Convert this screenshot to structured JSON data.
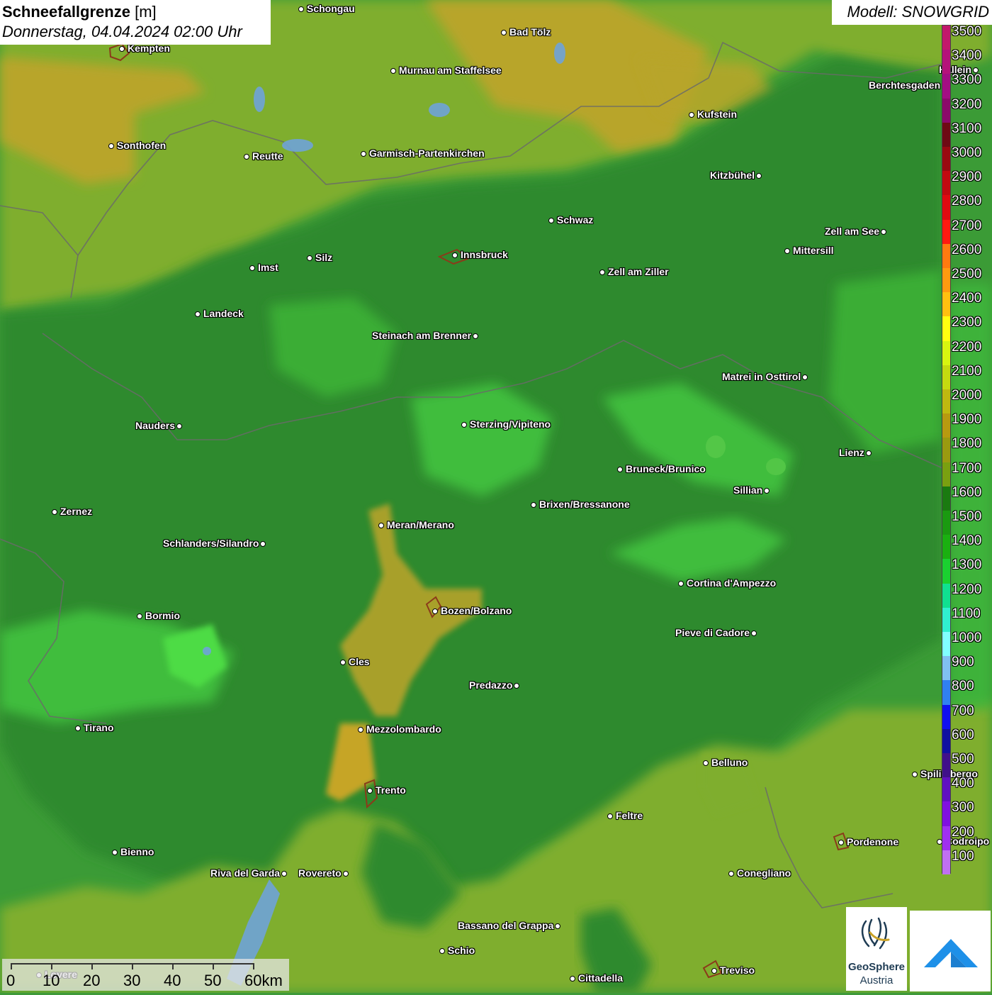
{
  "title": {
    "main": "Schneefallgrenze",
    "unit": "[m]",
    "datetime": "Donnerstag, 04.04.2024 02:00 Uhr"
  },
  "model": "Modell: SNOWGRID",
  "legend": {
    "labels": [
      "3500",
      "3400",
      "3300",
      "3200",
      "3100",
      "3000",
      "2900",
      "2800",
      "2700",
      "2600",
      "2500",
      "2400",
      "2300",
      "2200",
      "2100",
      "2000",
      "1900",
      "1800",
      "1700",
      "1600",
      "1500",
      "1400",
      "1300",
      "1200",
      "1100",
      "1000",
      "900",
      "800",
      "700",
      "600",
      "500",
      "400",
      "300",
      "200",
      "100"
    ],
    "colors": [
      "#c2186b",
      "#b5127a",
      "#a30e83",
      "#8c0a6a",
      "#6e0a14",
      "#9a0a10",
      "#c20a10",
      "#e00a10",
      "#ff1a10",
      "#ff7a10",
      "#ff9a10",
      "#ffc010",
      "#ffff10",
      "#d8f510",
      "#c4da10",
      "#c0b810",
      "#b89a10",
      "#9a9a10",
      "#7aa010",
      "#1a7a10",
      "#1a9a10",
      "#1ab010",
      "#1ad030",
      "#10e090",
      "#30f0d0",
      "#80ffff",
      "#80c0f0",
      "#3080f0",
      "#1010f0",
      "#1010a0",
      "#40108a",
      "#6010c0",
      "#8010e0",
      "#a030f0",
      "#c070f0"
    ]
  },
  "cities": [
    {
      "name": "Schongau"
    },
    {
      "name": "Bad Tölz"
    },
    {
      "name": "Kempten"
    },
    {
      "name": "Murnau am Staffelsee"
    },
    {
      "name": "Hallein"
    },
    {
      "name": "Berchtesgaden"
    },
    {
      "name": "Kufstein"
    },
    {
      "name": "Sonthofen"
    },
    {
      "name": "Reutte"
    },
    {
      "name": "Garmisch-Partenkirchen"
    },
    {
      "name": "Kitzbühel"
    },
    {
      "name": "Schwaz"
    },
    {
      "name": "Zell am See"
    },
    {
      "name": "Innsbruck"
    },
    {
      "name": "Mittersill"
    },
    {
      "name": "Silz"
    },
    {
      "name": "Imst"
    },
    {
      "name": "Zell am Ziller"
    },
    {
      "name": "Landeck"
    },
    {
      "name": "Steinach am Brenner"
    },
    {
      "name": "Matrei in Osttirol"
    },
    {
      "name": "Nauders"
    },
    {
      "name": "Sterzing/Vipiteno"
    },
    {
      "name": "Lienz"
    },
    {
      "name": "Bruneck/Brunico"
    },
    {
      "name": "Sillian"
    },
    {
      "name": "Brixen/Bressanone"
    },
    {
      "name": "Zernez"
    },
    {
      "name": "Meran/Merano"
    },
    {
      "name": "Schlanders/Silandro"
    },
    {
      "name": "Cortina d'Ampezzo"
    },
    {
      "name": "Bozen/Bolzano"
    },
    {
      "name": "Bormio"
    },
    {
      "name": "Pieve di Cadore"
    },
    {
      "name": "Cles"
    },
    {
      "name": "Predazzo"
    },
    {
      "name": "Tirano"
    },
    {
      "name": "Mezzolombardo"
    },
    {
      "name": "Belluno"
    },
    {
      "name": "Spilimbergo"
    },
    {
      "name": "Trento"
    },
    {
      "name": "Feltre"
    },
    {
      "name": "Pordenone"
    },
    {
      "name": "Codroipo"
    },
    {
      "name": "Bienno"
    },
    {
      "name": "Riva del Garda"
    },
    {
      "name": "Rovereto"
    },
    {
      "name": "Conegliano"
    },
    {
      "name": "Bassano del Grappa"
    },
    {
      "name": "Schio"
    },
    {
      "name": "Treviso"
    },
    {
      "name": "Cittadella"
    },
    {
      "name": "Lovere"
    }
  ],
  "scale": {
    "labels": [
      "0",
      "10",
      "20",
      "30",
      "40",
      "50",
      "60km"
    ]
  },
  "logo": {
    "line1": "GeoSphere",
    "line2": "Austria"
  }
}
